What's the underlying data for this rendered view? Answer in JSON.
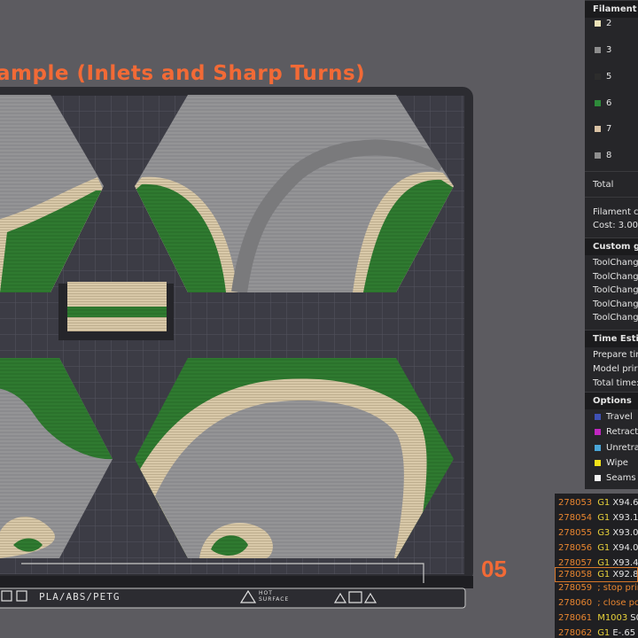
{
  "plate_title": "ample (Inlets and Sharp Turns)",
  "plate_number": "05",
  "bed_label": "PLA/ABS/PETG",
  "hot_surface_label": "HOT\nSURFACE",
  "colors": {
    "accent": "#f26a36",
    "grass": "#2e7d32",
    "sand": "#d8c7a8",
    "road": "#8a8a8c",
    "bed": "#3c3c44"
  },
  "legend": {
    "filament_header": "Filament",
    "filaments": [
      {
        "id": "2",
        "color": "#ede3b8"
      },
      {
        "id": "3",
        "color": "#8d8d8d"
      },
      {
        "id": "5",
        "color": "#2c2c2c"
      },
      {
        "id": "6",
        "color": "#2e8b3a"
      },
      {
        "id": "7",
        "color": "#d9c2a4"
      },
      {
        "id": "8",
        "color": "#8f8f8f"
      }
    ],
    "total_label": "Total",
    "filament_cost_label": "Filament c",
    "cost_label": "Cost:  3.00",
    "custom_gcode_header": "Custom g-",
    "toolchanges": [
      "ToolChang",
      "ToolChang",
      "ToolChang",
      "ToolChang",
      "ToolChang"
    ],
    "time_header": "Time Estin",
    "time_items": [
      "Prepare tir",
      "Model prir",
      "Total time:"
    ],
    "options_header": "Options",
    "options": [
      {
        "label": "Travel",
        "color": "#3f51b5"
      },
      {
        "label": "Retract",
        "color": "#c026c0"
      },
      {
        "label": "Unretra",
        "color": "#4aa6d8"
      },
      {
        "label": "Wipe",
        "color": "#f2e21a"
      },
      {
        "label": "Seams",
        "color": "#f4f4f4"
      }
    ]
  },
  "gcode": [
    {
      "line": "278053",
      "cmd": "G1",
      "args": "X94.6"
    },
    {
      "line": "278054",
      "cmd": "G1",
      "args": "X93.1"
    },
    {
      "line": "278055",
      "cmd": "G3",
      "args": "X93.0"
    },
    {
      "line": "278056",
      "cmd": "G1",
      "args": "X94.0"
    },
    {
      "line": "278057",
      "cmd": "G1",
      "args": "X93.4"
    },
    {
      "line": "278058",
      "cmd": "G1",
      "args": "X92.8"
    },
    {
      "line": "278059",
      "cmd": "",
      "args": "; stop prin"
    },
    {
      "line": "278060",
      "cmd": "",
      "args": "; close po"
    },
    {
      "line": "278061",
      "cmd": "M1003",
      "args": "S0"
    },
    {
      "line": "278062",
      "cmd": "G1",
      "args": "E-.65"
    }
  ]
}
